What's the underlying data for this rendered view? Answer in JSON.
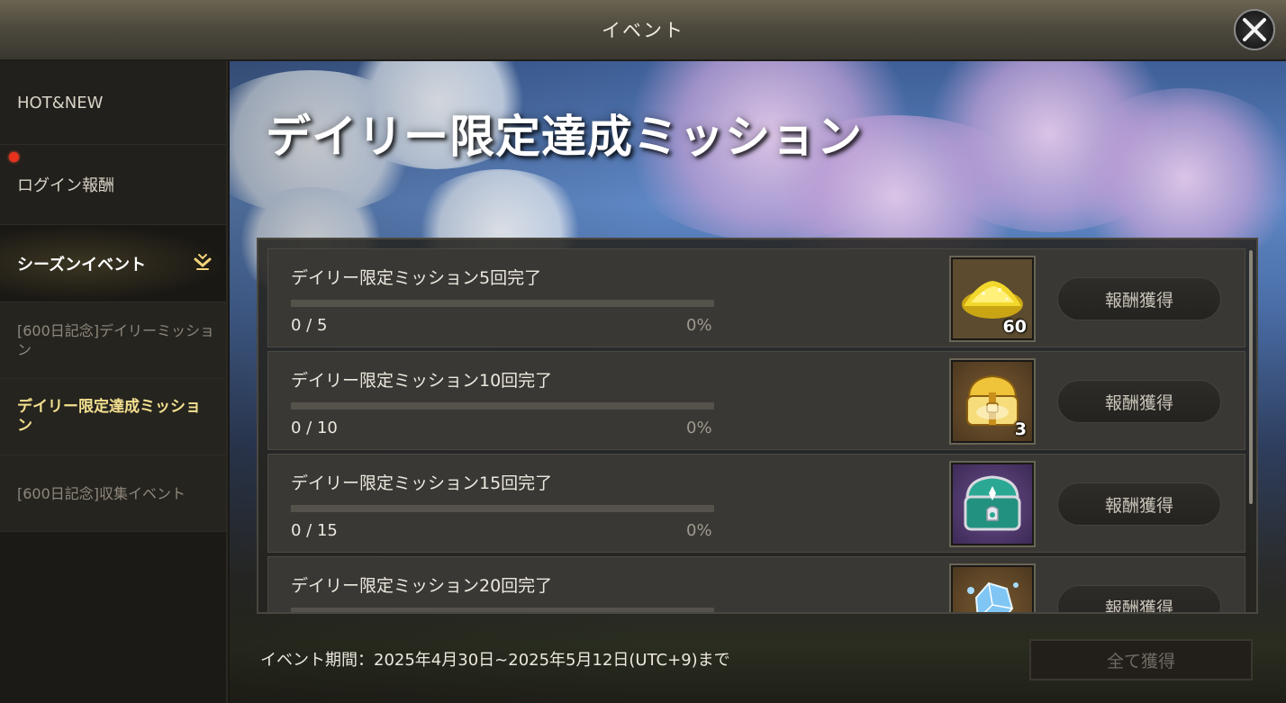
{
  "window": {
    "title": "イベント"
  },
  "sidebar": {
    "items": [
      {
        "label": "HOT&NEW"
      },
      {
        "label": "ログイン報酬",
        "has_notification": true
      },
      {
        "label": "シーズンイベント",
        "expanded": true
      },
      {
        "label": "[600日記念]デイリーミッション"
      },
      {
        "label": "デイリー限定達成ミッション",
        "selected": true
      },
      {
        "label": "[600日記念]収集イベント"
      }
    ]
  },
  "main": {
    "heading": "デイリー限定達成ミッション",
    "missions": [
      {
        "name": "デイリー限定ミッション5回完了",
        "progress": "0 / 5",
        "percent": "0%",
        "progress_value": 0,
        "reward_icon": "gold-dust-icon",
        "reward_qty": "60",
        "claim_label": "報酬獲得"
      },
      {
        "name": "デイリー限定ミッション10回完了",
        "progress": "0 / 10",
        "percent": "0%",
        "progress_value": 0,
        "reward_icon": "gold-chest-icon",
        "reward_qty": "3",
        "claim_label": "報酬獲得"
      },
      {
        "name": "デイリー限定ミッション15回完了",
        "progress": "0 / 15",
        "percent": "0%",
        "progress_value": 0,
        "reward_icon": "teal-chest-icon",
        "reward_qty": "",
        "claim_label": "報酬獲得"
      },
      {
        "name": "デイリー限定ミッション20回完了",
        "progress": "",
        "percent": "",
        "progress_value": 0,
        "reward_icon": "crystal-icon",
        "reward_qty": "",
        "claim_label": "報酬獲得"
      }
    ],
    "period": "イベント期間：2025年4月30日~2025年5月12日(UTC+9)まで",
    "claim_all_label": "全て獲得"
  },
  "colors": {
    "accent_gold": "#f3e08f",
    "notification_red": "#e8321e"
  }
}
